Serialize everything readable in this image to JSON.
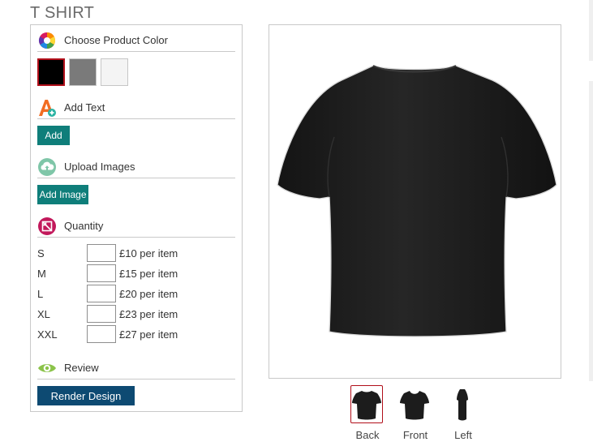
{
  "page": {
    "title": "T SHIRT"
  },
  "colors": {
    "accent_teal": "#0f7e7a",
    "accent_navy": "#0d4a72",
    "selected_border": "#b10f1a"
  },
  "sections": {
    "color": {
      "title": "Choose Product Color",
      "icon": "color-wheel-icon"
    },
    "text": {
      "title": "Add Text",
      "icon": "text-add-icon",
      "button": "Add"
    },
    "images": {
      "title": "Upload Images",
      "icon": "upload-cloud-icon",
      "button": "Add Image"
    },
    "quantity": {
      "title": "Quantity",
      "icon": "quantity-icon"
    },
    "review": {
      "title": "Review",
      "icon": "eye-icon",
      "button": "Render Design"
    }
  },
  "swatches": [
    {
      "name": "Black",
      "hex": "#000000",
      "selected": true
    },
    {
      "name": "Grey",
      "hex": "#7a7a7a",
      "selected": false
    },
    {
      "name": "White",
      "hex": "#f4f4f4",
      "selected": false
    }
  ],
  "quantity_rows": [
    {
      "size": "S",
      "value": "",
      "price": "£10 per item"
    },
    {
      "size": "M",
      "value": "",
      "price": "£15 per item"
    },
    {
      "size": "L",
      "value": "",
      "price": "£20 per item"
    },
    {
      "size": "XL",
      "value": "",
      "price": "£23 per item"
    },
    {
      "size": "XXL",
      "value": "",
      "price": "£27 per item"
    }
  ],
  "views": [
    {
      "label": "Back",
      "selected": true
    },
    {
      "label": "Front",
      "selected": false
    },
    {
      "label": "Left",
      "selected": false
    }
  ],
  "preview": {
    "shirt_color": "#1f1f1f",
    "view": "Back"
  }
}
